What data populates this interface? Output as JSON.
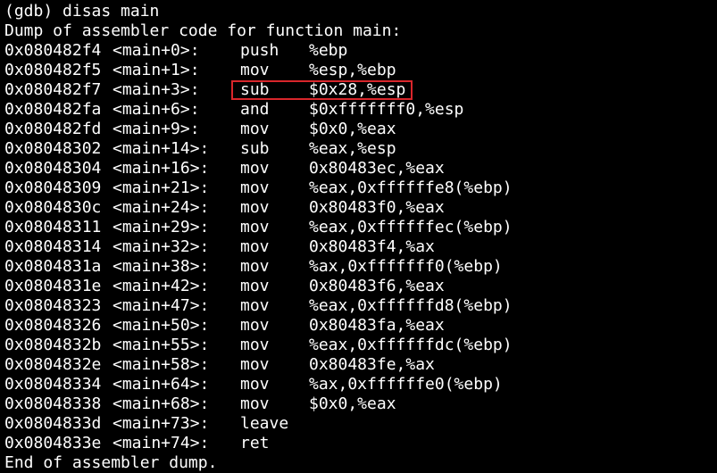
{
  "terminal": {
    "prompt_line": "(gdb) disas main",
    "header_line": "Dump of assembler code for function main:",
    "footer_line": "End of assembler dump.",
    "highlight_color": "#d9262b",
    "text_color": "#ffffff",
    "background_color": "#000000",
    "instructions": [
      {
        "address": "0x080482f4",
        "symbol": "<main+0>:",
        "mnemonic": "push",
        "operands": "%ebp"
      },
      {
        "address": "0x080482f5",
        "symbol": "<main+1>:",
        "mnemonic": "mov",
        "operands": "%esp,%ebp"
      },
      {
        "address": "0x080482f7",
        "symbol": "<main+3>:",
        "mnemonic": "sub",
        "operands": "$0x28,%esp",
        "highlighted": true
      },
      {
        "address": "0x080482fa",
        "symbol": "<main+6>:",
        "mnemonic": "and",
        "operands": "$0xfffffff0,%esp"
      },
      {
        "address": "0x080482fd",
        "symbol": "<main+9>:",
        "mnemonic": "mov",
        "operands": "$0x0,%eax"
      },
      {
        "address": "0x08048302",
        "symbol": "<main+14>:",
        "mnemonic": "sub",
        "operands": "%eax,%esp"
      },
      {
        "address": "0x08048304",
        "symbol": "<main+16>:",
        "mnemonic": "mov",
        "operands": "0x80483ec,%eax"
      },
      {
        "address": "0x08048309",
        "symbol": "<main+21>:",
        "mnemonic": "mov",
        "operands": "%eax,0xffffffe8(%ebp)"
      },
      {
        "address": "0x0804830c",
        "symbol": "<main+24>:",
        "mnemonic": "mov",
        "operands": "0x80483f0,%eax"
      },
      {
        "address": "0x08048311",
        "symbol": "<main+29>:",
        "mnemonic": "mov",
        "operands": "%eax,0xffffffec(%ebp)"
      },
      {
        "address": "0x08048314",
        "symbol": "<main+32>:",
        "mnemonic": "mov",
        "operands": "0x80483f4,%ax"
      },
      {
        "address": "0x0804831a",
        "symbol": "<main+38>:",
        "mnemonic": "mov",
        "operands": "%ax,0xfffffff0(%ebp)"
      },
      {
        "address": "0x0804831e",
        "symbol": "<main+42>:",
        "mnemonic": "mov",
        "operands": "0x80483f6,%eax"
      },
      {
        "address": "0x08048323",
        "symbol": "<main+47>:",
        "mnemonic": "mov",
        "operands": "%eax,0xffffffd8(%ebp)"
      },
      {
        "address": "0x08048326",
        "symbol": "<main+50>:",
        "mnemonic": "mov",
        "operands": "0x80483fa,%eax"
      },
      {
        "address": "0x0804832b",
        "symbol": "<main+55>:",
        "mnemonic": "mov",
        "operands": "%eax,0xffffffdc(%ebp)"
      },
      {
        "address": "0x0804832e",
        "symbol": "<main+58>:",
        "mnemonic": "mov",
        "operands": "0x80483fe,%ax"
      },
      {
        "address": "0x08048334",
        "symbol": "<main+64>:",
        "mnemonic": "mov",
        "operands": "%ax,0xffffffe0(%ebp)"
      },
      {
        "address": "0x08048338",
        "symbol": "<main+68>:",
        "mnemonic": "mov",
        "operands": "$0x0,%eax"
      },
      {
        "address": "0x0804833d",
        "symbol": "<main+73>:",
        "mnemonic": "leave",
        "operands": ""
      },
      {
        "address": "0x0804833e",
        "symbol": "<main+74>:",
        "mnemonic": "ret",
        "operands": ""
      }
    ]
  }
}
